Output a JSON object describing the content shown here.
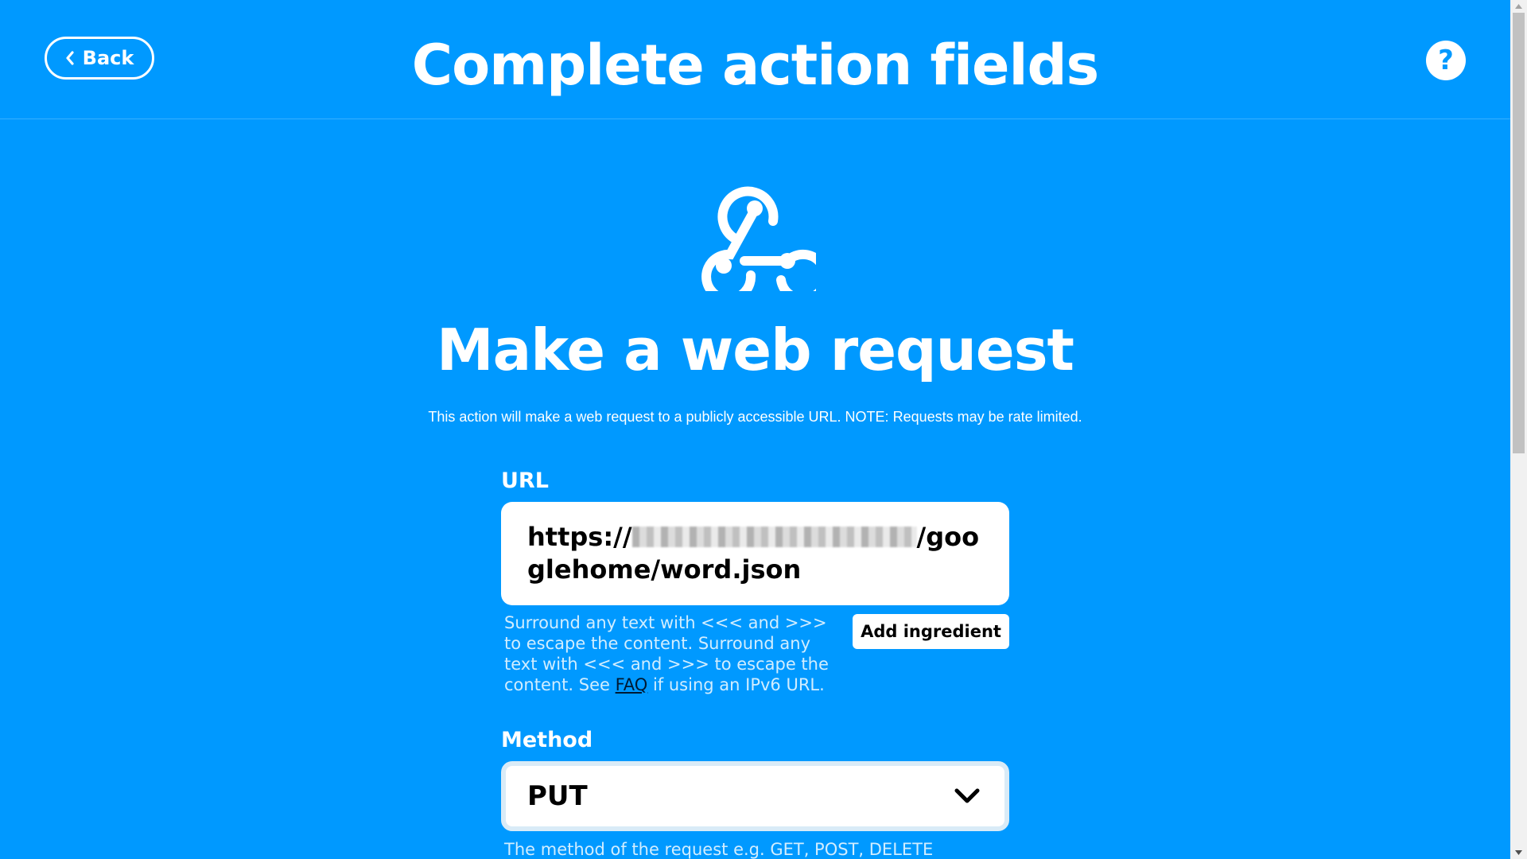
{
  "header": {
    "back_label": "Back",
    "title": "Complete action fields",
    "help_label": "?"
  },
  "service": {
    "icon": "webhook-icon",
    "title": "Make a web request",
    "description": "This action will make a web request to a publicly accessible URL. NOTE: Requests may be rate limited."
  },
  "url_field": {
    "label": "URL",
    "value_prefix": "https://",
    "value_suffix": "/googlehome/word.json",
    "help_text_before_link": "Surround any text with <<< and >>> to escape the content. Surround any text with <<< and >>> to escape the content. See ",
    "help_link": "FAQ",
    "help_text_after_link": " if using an IPv6 URL.",
    "add_ingredient_label": "Add ingredient"
  },
  "method_field": {
    "label": "Method",
    "selected": "PUT",
    "help_text": "The method of the request e.g. GET, POST, DELETE"
  },
  "colors": {
    "background": "#0099ff",
    "text": "#ffffff"
  }
}
